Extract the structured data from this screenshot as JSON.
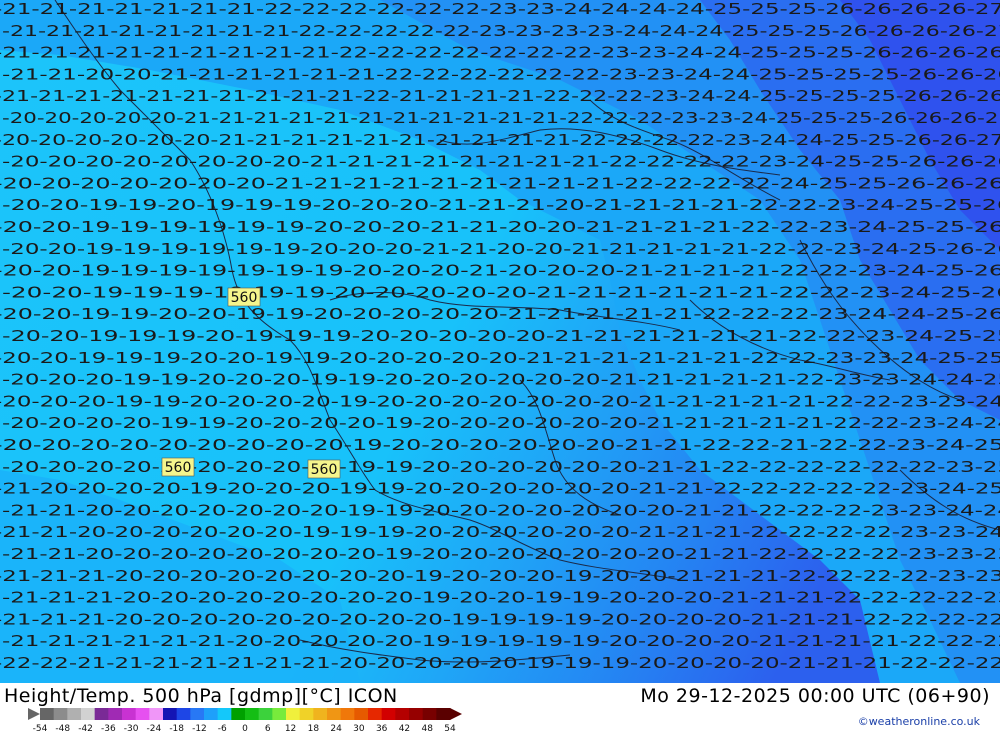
{
  "map": {
    "colors": {
      "deep_blue": "#2a55f0",
      "mid_blue": "#1e8cf5",
      "light_blue": "#1cb8f8",
      "cyan": "#17d0fb",
      "box_fill": "#f5f58c",
      "text": "#1a1a1a"
    },
    "contour_labels": [
      "560",
      "560",
      "560"
    ],
    "rows": [
      "-21-21-21-21-21-21-21-22-22-22-22-22-22-23-23-24-24-24-24-25-25-25-26-26-26-26-27",
      "-21-21-21-21-21-21-21-21-22-22-22-22-22-23-23-23-23-24-24-24-25-25-25-26-26-26-26-27",
      "-21-21-21-21-21-21-21-21-21-22-22-22-22-22-22-22-23-23-24-24-25-25-25-26-26-26-26",
      "-21-21-20-20-21-21-21-21-21-21-22-22-22-22-22-22-23-23-24-24-25-25-25-25-26-26-26",
      "-21-21-21-21-21-21-21-21-21-21-22-21-21-21-21-22-22-22-23-24-24-25-25-25-25-26-26-26",
      "-20-20-20-20-20-21-21-21-21-21-21-21-21-21-21-21-22-22-22-23-23-24-25-25-25-26-26-26-27",
      "-20-20-20-20-20-20-21-21-21-21-21-21-21-21-21-21-22-22-22-22-23-24-24-25-25-26-26-27",
      "-20-20-20-20-20-20-20-20-21-21-21-21-21-21-21-21-22-22-22-22-23-24-25-25-26-26-26",
      "-20-20-20-20-20-20-20-21-21-21-21-21-21-21-21-21-22-22-22-22-24-25-25-26-26-26",
      "-20-20-19-19-20-19-19-19-20-20-20-21-21-21-20-21-21-21-21-22-22-23-24-25-25-26",
      "-20-20-19-19-19-19-19-19-20-20-20-21-21-20-20-21-21-21-21-22-22-23-24-25-25-26",
      "-20-20-19-19-19-19-19-19-20-20-20-21-21-20-20-21-21-21-21-21-22-22-23-24-25-26-26",
      "-20-20-19-19-19-19-19-19-19-20-20-20-21-20-20-20-21-21-21-21-22-22-23-24-25-26",
      "-20-20-19-19-19-19-19-19-20-20-20-20-20-21-21-21-21-21-21-22-22-23-24-25-26",
      "-20-20-19-19-20-20-19-19-20-20-20-20-20-21-21-21-21-21-22-22-22-23-24-24-25-26",
      "-20-20-19-19-19-20-19-19-19-20-20-20-20-20-21-21-21-21-21-21-22-22-23-24-25-25",
      "-20-20-19-19-19-20-20-19-19-20-20-20-20-20-21-21-21-21-21-21-22-22-23-23-24-25-25",
      "-20-20-20-19-19-20-20-20-19-19-20-20-20-20-20-20-21-21-21-21-21-22-23-23-24-24-25",
      "-20-20-20-19-19-20-20-20-20-19-20-20-20-20-20-20-20-21-21-21-21-21-22-22-23-23-24",
      "-20-20-20-20-19-19-20-20-20-20-19-20-20-20-20-20-20-21-21-21-21-21-22-22-23-24-24",
      "-20-20-20-20-20-20-20-20-20-19-20-20-20-20-20-20-21-21-22-22-21-22-22-23-24-25",
      "-20-20-20-20-20-20-20-20-20-19-19-20-20-20-20-20-20-21-21-22-22-22-22-22-22-23-25",
      "-21-20-20-20-20-19-20-20-20-19-19-20-20-20-20-20-20-21-21-22-22-22-22-22-23-24-25",
      "-21-21-20-20-20-20-20-20-20-19-19-20-20-20-20-20-20-20-21-21-22-22-22-23-23-24-24",
      "-21-21-20-20-20-20-20-20-19-19-19-20-20-20-20-20-20-21-21-21-22-22-22-22-23-23-24",
      "-21-21-20-20-20-20-20-20-20-20-19-20-20-20-20-20-20-20-21-21-22-22-22-22-23-23-23",
      "-21-21-21-20-20-20-20-20-20-20-20-19-20-20-20-19-20-20-21-21-21-22-22-22-22-23-23",
      "-21-21-21-20-20-20-20-20-20-20-20-19-20-20-19-19-20-20-20-21-21-21-22-22-22-22-23",
      "-21-21-21-20-20-20-20-20-20-20-20-20-19-19-19-19-20-20-20-20-21-21-21-22-22-22-22",
      "-21-21-21-21-21-21-20-20-20-20-20-19-19-19-19-19-20-20-20-20-21-21-21-21-22-22-22",
      "-22-22-21-21-21-21-21-21-21-20-20-20-20-20-19-19-19-20-20-20-20-21-21-21-22-22-22"
    ]
  },
  "footer": {
    "title_left": "Height/Temp. 500 hPa [gdmp][°C] ICON",
    "title_right": "Mo 29-12-2025 00:00 UTC (06+90)",
    "credit": "©weatheronline.co.uk",
    "scale_labels": [
      "-54",
      "-48",
      "-42",
      "-36",
      "-30",
      "-24",
      "-18",
      "-12",
      "-6",
      "0",
      "6",
      "12",
      "18",
      "24",
      "30",
      "36",
      "42",
      "48",
      "54"
    ],
    "scale_colors": [
      "#666666",
      "#8c8c8c",
      "#b0b0b0",
      "#d2d2d2",
      "#7a2a96",
      "#a02ab4",
      "#c832d2",
      "#e650f0",
      "#f096f8",
      "#1414b4",
      "#1e46e6",
      "#2878f5",
      "#1ea0fa",
      "#14c8fa",
      "#00a000",
      "#14be14",
      "#3cd23c",
      "#78eb3c",
      "#f0f03c",
      "#f0d228",
      "#f0b41e",
      "#f09614",
      "#f0780a",
      "#e65a00",
      "#e62800",
      "#d20000",
      "#b40000",
      "#960000",
      "#780000",
      "#5a0000"
    ]
  }
}
